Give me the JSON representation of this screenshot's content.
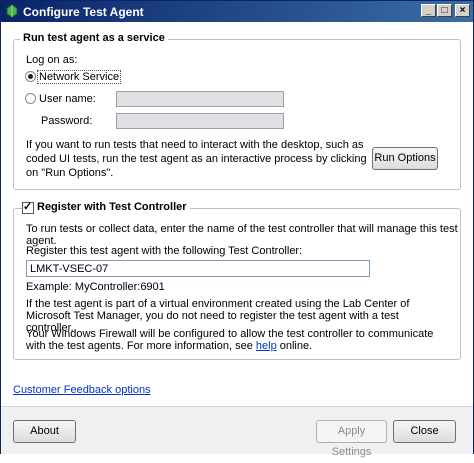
{
  "window": {
    "title": "Configure Test Agent",
    "controls": {
      "minimize": "_",
      "maximize": "□",
      "close": "×"
    }
  },
  "service_group": {
    "title": "Run test agent as a service",
    "logon_label": "Log on as:",
    "network_service_label": "Network Service",
    "user_name_label": "User name:",
    "password_label": "Password:",
    "user_name_value": "",
    "password_value": "",
    "description": "If you want to run tests that need to interact with the desktop, such as coded UI tests, run the test agent as an interactive process by clicking on \"Run Options\".",
    "run_options_button": "Run Options"
  },
  "controller_group": {
    "title": "Register with Test Controller",
    "checked": true,
    "intro": "To run tests or collect data, enter the name of the test controller that will manage this test agent.",
    "register_label": "Register this test agent with the following Test Controller:",
    "controller_value": "LMKT-VSEC-07",
    "example": "Example: MyController:6901",
    "virtual_note": "If the test agent is part of a virtual environment created using the Lab Center of Microsoft Test Manager, you do not need to register the test agent with a test controller.",
    "firewall_note_before": "Your Windows Firewall will be configured to allow the test controller to communicate with the test agents. For more information, see ",
    "help_link": "help",
    "firewall_note_after": " online."
  },
  "feedback_link": "Customer Feedback options",
  "footer": {
    "about_button": "About",
    "apply_button": "Apply Settings",
    "close_button": "Close"
  }
}
